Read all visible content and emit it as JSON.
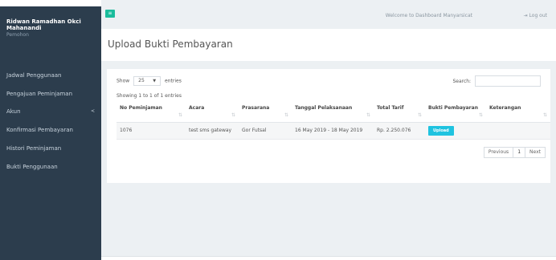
{
  "sidebar": {
    "user_name": "Ridwan Ramadhan Okci Mahanandi",
    "user_role": "Pemohon",
    "items": [
      {
        "label": "Jadwal Penggunaan"
      },
      {
        "label": "Pengajuan Peminjaman"
      },
      {
        "label": "Akun",
        "chevron": "<"
      },
      {
        "label": "Konfirmasi Pembayaran"
      },
      {
        "label": "Histori Peminjaman"
      },
      {
        "label": "Bukti Penggunaan"
      }
    ]
  },
  "topbar": {
    "menu_icon": "≡",
    "welcome": "Welcome to Dashboard Manyarsicat",
    "logout_icon": "⇥",
    "logout": "Log out"
  },
  "page": {
    "title": "Upload Bukti Pembayaran"
  },
  "table_controls": {
    "show_label": "Show",
    "entries_value": "25",
    "entries_label": "entries",
    "search_label": "Search:",
    "info": "Showing 1 to 1 of 1 entries"
  },
  "table": {
    "headers": [
      "No Peminjaman",
      "Acara",
      "Prasarana",
      "Tanggal Pelaksanaan",
      "Total Tarif",
      "Bukti Pembayaran",
      "Keterangan"
    ],
    "rows": [
      {
        "no": "1076",
        "acara": "test sms gateway",
        "prasarana": "Gor Futsal",
        "tanggal": "16 May 2019 - 18 May 2019",
        "tarif": "Rp. 2.250.076",
        "upload_label": "Upload",
        "keterangan": ""
      }
    ]
  },
  "pagination": {
    "previous": "Previous",
    "page": "1",
    "next": "Next"
  },
  "colors": {
    "sidebar": "#2c3d4d",
    "accent": "#1abc9c",
    "upload_button": "#1fc3e0"
  }
}
